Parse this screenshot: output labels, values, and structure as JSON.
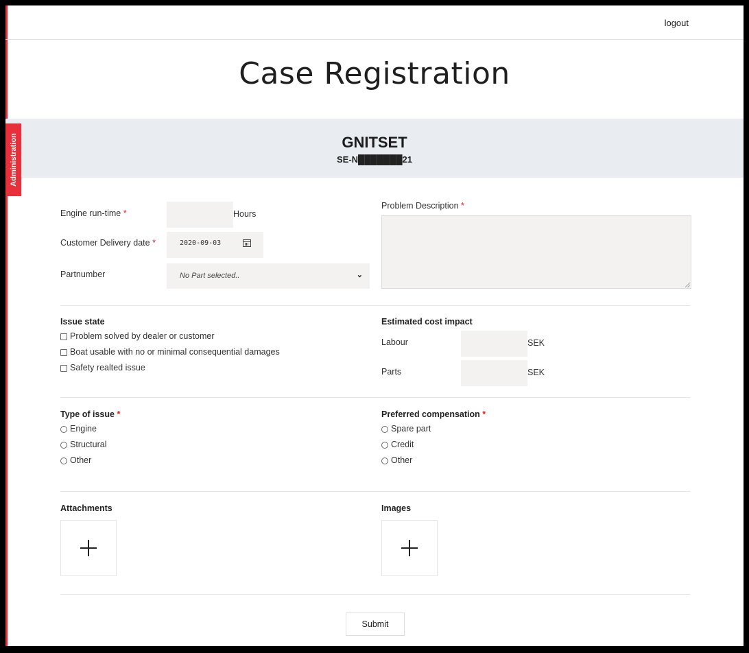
{
  "header": {
    "logout_label": "logout"
  },
  "page_title": "Case Registration",
  "admin_tab_label": "Administration",
  "banner": {
    "name": "GNITSET",
    "id": "SE-N███████21"
  },
  "engine_runtime": {
    "label": "Engine run-time",
    "required": "*",
    "value": "",
    "unit": "Hours"
  },
  "delivery_date": {
    "label": "Customer Delivery date",
    "required": "*",
    "value": "2020-09-03"
  },
  "partnumber": {
    "label": "Partnumber",
    "selected": "No Part selected.."
  },
  "problem_description": {
    "label": "Problem Description",
    "required": "*",
    "value": ""
  },
  "issue_state": {
    "title": "Issue state",
    "options": [
      "Problem solved by dealer or customer",
      "Boat usable with no or minimal consequential damages",
      "Safety realted issue"
    ]
  },
  "cost_impact": {
    "title": "Estimated cost impact",
    "labour": {
      "label": "Labour",
      "value": "",
      "unit": "SEK"
    },
    "parts": {
      "label": "Parts",
      "value": "",
      "unit": "SEK"
    }
  },
  "type_of_issue": {
    "title": "Type of issue",
    "required": "*",
    "options": [
      "Engine",
      "Structural",
      "Other"
    ]
  },
  "preferred_compensation": {
    "title": "Preferred compensation",
    "required": "*",
    "options": [
      "Spare part",
      "Credit",
      "Other"
    ]
  },
  "attachments": {
    "title": "Attachments"
  },
  "images": {
    "title": "Images"
  },
  "submit_label": "Submit",
  "colors": {
    "accent": "#e8303a",
    "banner_bg": "#e9edf1",
    "input_bg": "#f3f2f0"
  },
  "icons": [
    "calendar-icon",
    "chevron-down-icon",
    "plus-icon"
  ]
}
